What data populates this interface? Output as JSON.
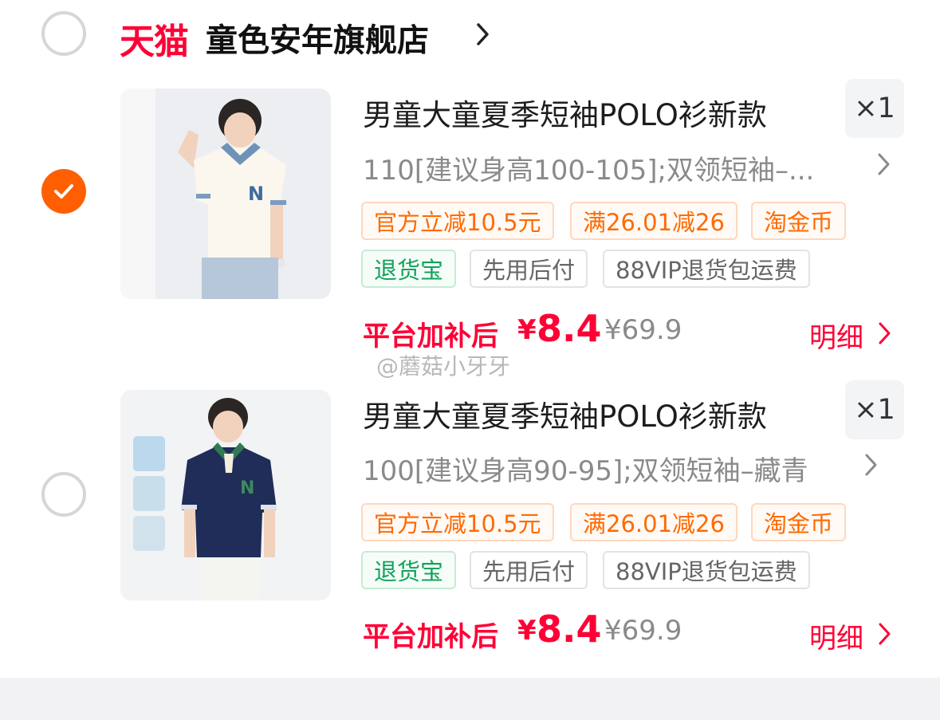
{
  "store": {
    "platform_logo": "天猫",
    "name": "童色安年旗舰店"
  },
  "items": [
    {
      "checked": false,
      "title": "男童大童夏季短袖POLO衫新款",
      "quantity": "×1",
      "sku": "110[建议身高100-105];双领短袖–...",
      "tags": [
        {
          "text": "官方立减10.5元",
          "style": "orange"
        },
        {
          "text": "满26.01减26",
          "style": "orange"
        },
        {
          "text": "淘金币",
          "style": "orange"
        },
        {
          "text": "退货宝",
          "style": "green"
        },
        {
          "text": "先用后付",
          "style": "gray"
        },
        {
          "text": "88VIP退货包运费",
          "style": "gray"
        }
      ],
      "price_label": "平台加补后",
      "currency": "¥",
      "price": "8.4",
      "original_price": "¥69.9",
      "detail_label": "明细"
    },
    {
      "checked": false,
      "title": "男童大童夏季短袖POLO衫新款",
      "quantity": "×1",
      "sku": "100[建议身高90-95];双领短袖–藏青",
      "tags": [
        {
          "text": "官方立减10.5元",
          "style": "orange"
        },
        {
          "text": "满26.01减26",
          "style": "orange"
        },
        {
          "text": "淘金币",
          "style": "orange"
        },
        {
          "text": "退货宝",
          "style": "green"
        },
        {
          "text": "先用后付",
          "style": "gray"
        },
        {
          "text": "88VIP退货包运费",
          "style": "gray"
        }
      ],
      "price_label": "平台加补后",
      "currency": "¥",
      "price": "8.4",
      "original_price": "¥69.9",
      "detail_label": "明细"
    }
  ],
  "item1_selected": true,
  "watermark": "@蘑菇小牙牙",
  "colors": {
    "accent_red": "#ff0036",
    "check_orange": "#ff5f00",
    "tag_orange": "#ff6a00",
    "tag_green": "#11a35a"
  }
}
